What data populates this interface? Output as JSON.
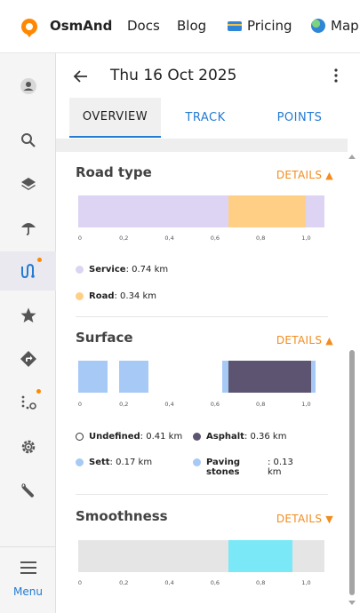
{
  "topnav": {
    "brand": "OsmAnd",
    "links": [
      "Docs",
      "Blog",
      "Pricing",
      "Map"
    ],
    "logo_icon": "osmand-logo-icon",
    "pricing_icon": "credit-card-icon",
    "map_icon": "globe-icon"
  },
  "sidebar": {
    "items": [
      {
        "icon": "avatar-icon"
      },
      {
        "icon": "search-icon"
      },
      {
        "icon": "layers-icon"
      },
      {
        "icon": "weather-umbrella-icon"
      },
      {
        "icon": "route-tracks-icon",
        "active": true,
        "badge": true
      },
      {
        "icon": "star-icon"
      },
      {
        "icon": "directions-icon"
      },
      {
        "icon": "navigation-dots-icon",
        "badge": true
      },
      {
        "icon": "gear-icon"
      },
      {
        "icon": "wrench-icon"
      }
    ],
    "menu_label": "Menu"
  },
  "header": {
    "title": "Thu 16 Oct 2025",
    "tabs": [
      "OVERVIEW",
      "TRACK",
      "POINTS"
    ],
    "active_tab": "OVERVIEW"
  },
  "sections": [
    {
      "title": "Road type",
      "details_label": "DETAILS",
      "expanded": true,
      "ticks": [
        "0",
        "0,2",
        "0,4",
        "0,6",
        "0,8",
        "1,0"
      ],
      "legend": [
        {
          "name": "Service",
          "value": ": 0.74 km",
          "color": "#dcd4f2"
        },
        {
          "name": "Road",
          "value": ": 0.34 km",
          "color": "#ffcf85"
        }
      ]
    },
    {
      "title": "Surface",
      "details_label": "DETAILS",
      "expanded": true,
      "ticks": [
        "0",
        "0,2",
        "0,4",
        "0,6",
        "0,8",
        "1,0"
      ],
      "legend": [
        {
          "name": "Undefined",
          "value": ": 0.41 km",
          "color": "#ffffff"
        },
        {
          "name": "Asphalt",
          "value": ": 0.36 km",
          "color": "#5c5470"
        },
        {
          "name": "Sett",
          "value": ": 0.17 km",
          "color": "#a7c9f5"
        },
        {
          "name": "Paving stones",
          "value": ": 0.13 km",
          "color": "#a7c9f5"
        }
      ]
    },
    {
      "title": "Smoothness",
      "details_label": "DETAILS",
      "expanded": false,
      "ticks": [
        "0",
        "0,2",
        "0,4",
        "0,6",
        "0,8",
        "1,0"
      ],
      "legend": []
    }
  ],
  "chart_data": [
    {
      "type": "bar",
      "title": "Road type",
      "xlim": [
        0,
        1.08
      ],
      "segments": [
        {
          "category": "Service",
          "from": 0,
          "to": 0.66,
          "color": "#dcd4f2"
        },
        {
          "category": "Road",
          "from": 0.66,
          "to": 1.0,
          "color": "#ffcf85"
        },
        {
          "category": "Service",
          "from": 1.0,
          "to": 1.08,
          "color": "#dcd4f2"
        }
      ]
    },
    {
      "type": "bar",
      "title": "Surface",
      "xlim": [
        0,
        1.08
      ],
      "segments": [
        {
          "category": "Sett",
          "from": 0,
          "to": 0.13,
          "color": "#a7c9f5"
        },
        {
          "category": "Sett",
          "from": 0.18,
          "to": 0.31,
          "color": "#a7c9f5"
        },
        {
          "category": "Paving stones",
          "from": 0.63,
          "to": 0.66,
          "color": "#a7c9f5"
        },
        {
          "category": "Asphalt",
          "from": 0.66,
          "to": 1.02,
          "color": "#5c5470"
        },
        {
          "category": "Paving stones",
          "from": 1.02,
          "to": 1.04,
          "color": "#a7c9f5"
        }
      ]
    },
    {
      "type": "bar",
      "title": "Smoothness",
      "xlim": [
        0,
        1.08
      ],
      "segments": [
        {
          "category": "Background",
          "from": 0,
          "to": 0.66,
          "color": "#e5e5e5"
        },
        {
          "category": "Highlighted",
          "from": 0.66,
          "to": 0.94,
          "color": "#7ae8f7"
        },
        {
          "category": "Background",
          "from": 0.94,
          "to": 1.08,
          "color": "#e5e5e5"
        }
      ]
    }
  ]
}
